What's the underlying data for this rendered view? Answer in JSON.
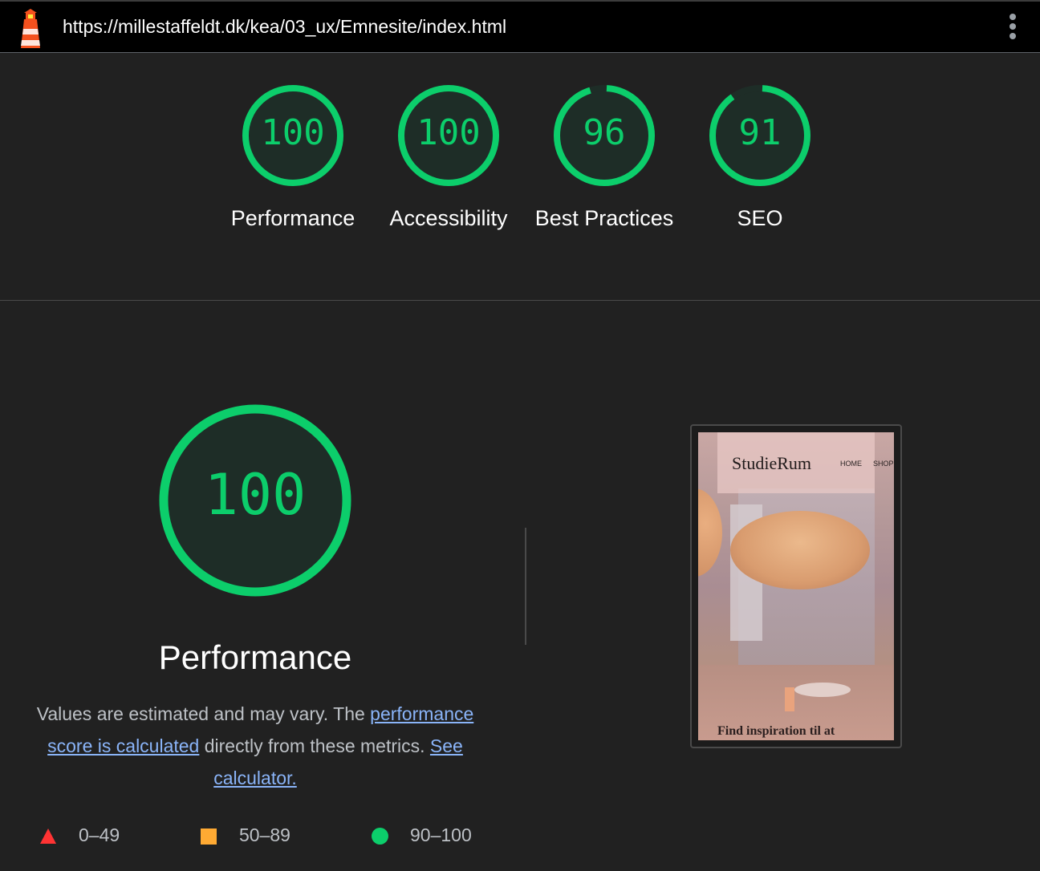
{
  "topbar": {
    "url": "https://millestaffeldt.dk/kea/03_ux/Emnesite/index.html",
    "logo_icon": "lighthouse-icon",
    "menu_icon": "more-vert-icon"
  },
  "colors": {
    "pass": "#0cce6b",
    "average": "#ffaa33",
    "fail": "#ff3333",
    "background": "#212121",
    "link": "#8ab4f8"
  },
  "gauges": [
    {
      "label": "Performance",
      "score": 100
    },
    {
      "label": "Accessibility",
      "score": 100
    },
    {
      "label": "Best Practices",
      "score": 96
    },
    {
      "label": "SEO",
      "score": 91
    }
  ],
  "performance": {
    "score": "100",
    "title": "Performance",
    "desc_prefix": "Values are estimated and may vary. The",
    "link1": "performance score is calculated",
    "desc_middle": "directly from these metrics.",
    "link2": "See calculator."
  },
  "legend": {
    "fail": "0–49",
    "average": "50–89",
    "pass": "90–100"
  },
  "thumbnail": {
    "brand": "StudieRum",
    "nav": [
      "HOME",
      "SHOP"
    ],
    "tagline": "Find inspiration til at"
  }
}
